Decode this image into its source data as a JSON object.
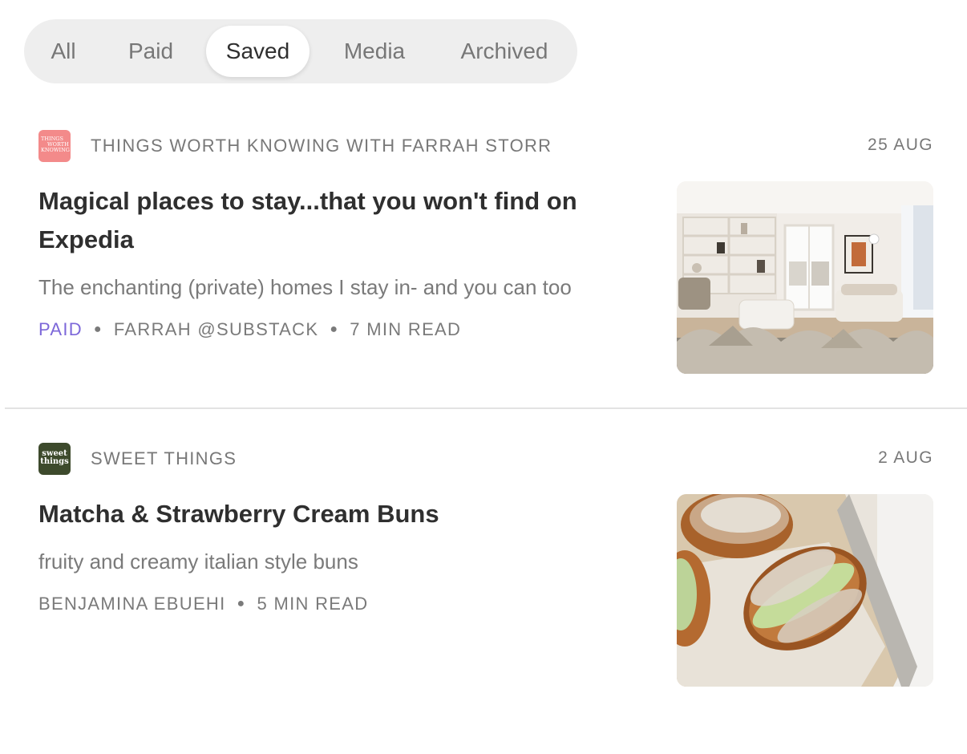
{
  "tabs": [
    {
      "label": "All",
      "active": false
    },
    {
      "label": "Paid",
      "active": false
    },
    {
      "label": "Saved",
      "active": true
    },
    {
      "label": "Media",
      "active": false
    },
    {
      "label": "Archived",
      "active": false
    }
  ],
  "posts": [
    {
      "publication": "THINGS WORTH KNOWING WITH FARRAH STORR",
      "logo_lines": [
        "THINGS",
        "WORTH",
        "KNOWING"
      ],
      "logo_color": "#f38a8a",
      "date": "25 AUG",
      "title": "Magical places to stay...that you won't find on Expedia",
      "subtitle": "The enchanting (private) homes I stay in- and you can too",
      "paid_label": "PAID",
      "author": "FARRAH @SUBSTACK",
      "read_time": "7 MIN READ",
      "thumbnail": "living-room-photo"
    },
    {
      "publication": "SWEET THINGS",
      "logo_lines": [
        "sweet",
        "things"
      ],
      "logo_color": "#3d4a2c",
      "date": "2 AUG",
      "title": "Matcha & Strawberry Cream Buns",
      "subtitle": "fruity and creamy italian style buns",
      "author": "BENJAMINA EBUEHI",
      "read_time": "5 MIN READ",
      "thumbnail": "matcha-buns-photo"
    }
  ],
  "colors": {
    "paid_accent": "#7c67d9",
    "muted_text": "#787878",
    "title_text": "#2f2f2f",
    "tab_bar_bg": "#eeeeee"
  }
}
